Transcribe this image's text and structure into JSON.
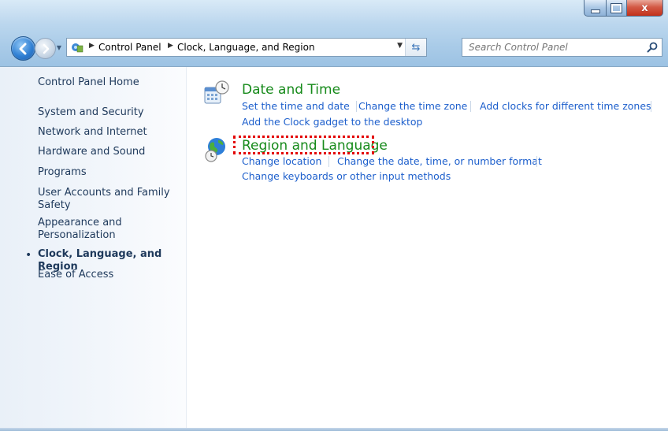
{
  "window": {
    "minimize_label": "–",
    "maximize_label": "□",
    "close_label": "x"
  },
  "address": {
    "root": "Control Panel",
    "current": "Clock, Language, and Region",
    "separator": "▶"
  },
  "search": {
    "placeholder": "Search Control Panel"
  },
  "leftnav": {
    "items": [
      {
        "label": "Control Panel Home"
      },
      {
        "label": "System and Security"
      },
      {
        "label": "Network and Internet"
      },
      {
        "label": "Hardware and Sound"
      },
      {
        "label": "Programs"
      },
      {
        "label": "User Accounts and Family Safety"
      },
      {
        "label": "Appearance and Personalization"
      },
      {
        "label": "Clock, Language, and Region",
        "selected": true
      },
      {
        "label": "Ease of Access"
      }
    ],
    "bullet": "•"
  },
  "categories": [
    {
      "title": "Date and Time",
      "icon": "calendar-clock-icon",
      "tasks": [
        "Set the time and date",
        "Change the time zone",
        "Add clocks for different time zones",
        "Add the Clock gadget to the desktop"
      ]
    },
    {
      "title": "Region and Language",
      "icon": "globe-clock-icon",
      "highlighted": true,
      "tasks": [
        "Change location",
        "Change the date, time, or number format",
        "Change keyboards or other input methods"
      ]
    }
  ],
  "colors": {
    "category_title": "#168a1a",
    "task_link": "#1d5fcc",
    "nav_text": "#1e395b",
    "highlight": "#e30000"
  }
}
